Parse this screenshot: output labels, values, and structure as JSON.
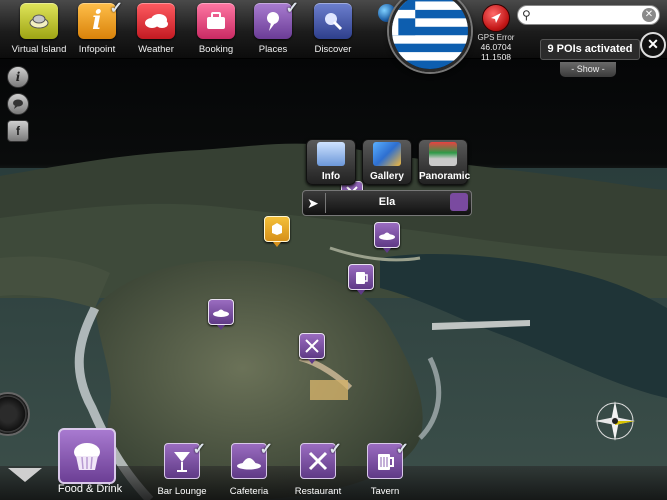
{
  "toolbar": {
    "buttons": [
      {
        "label": "Virtual Island",
        "icon": "virtual-island-icon",
        "color": "#c9cf3a",
        "checked": false
      },
      {
        "label": "Infopoint",
        "icon": "info-icon",
        "color": "#f5a11c",
        "checked": true
      },
      {
        "label": "Weather",
        "icon": "cloud-icon",
        "color": "#e7383f",
        "checked": false
      },
      {
        "label": "Booking",
        "icon": "suitcase-icon",
        "color": "#e4487f",
        "checked": false
      },
      {
        "label": "Places",
        "icon": "pin-icon",
        "color": "#8b58b7",
        "checked": true
      },
      {
        "label": "Discover",
        "icon": "discover-icon",
        "color": "#4c5fae",
        "checked": false
      }
    ],
    "gps": {
      "status": "GPS Error",
      "lat": "46.0704",
      "lon": "11.1508"
    },
    "search": {
      "placeholder": "",
      "value": ""
    },
    "pois_activated": "9 POIs activated",
    "show_label": "- Show -"
  },
  "flag": {
    "country": "Greece",
    "blue": "#0d5eaf"
  },
  "poi_panel": {
    "buttons": [
      {
        "label": "Info",
        "icon": "document-icon"
      },
      {
        "label": "Gallery",
        "icon": "photos-icon"
      },
      {
        "label": "Panoramic",
        "icon": "panorama-icon"
      }
    ],
    "name": "Ela"
  },
  "categories": {
    "featured": {
      "label": "Food & Drink",
      "icon": "cupcake-icon"
    },
    "items": [
      {
        "label": "Bar Lounge",
        "icon": "cocktail-icon",
        "checked": true
      },
      {
        "label": "Cafeteria",
        "icon": "coffee-icon",
        "checked": true
      },
      {
        "label": "Restaurant",
        "icon": "cutlery-icon",
        "checked": true
      },
      {
        "label": "Tavern",
        "icon": "beer-icon",
        "checked": true
      }
    ]
  },
  "colors": {
    "accent": "#7a4aa0",
    "poi_yellow": "#f4b331"
  }
}
